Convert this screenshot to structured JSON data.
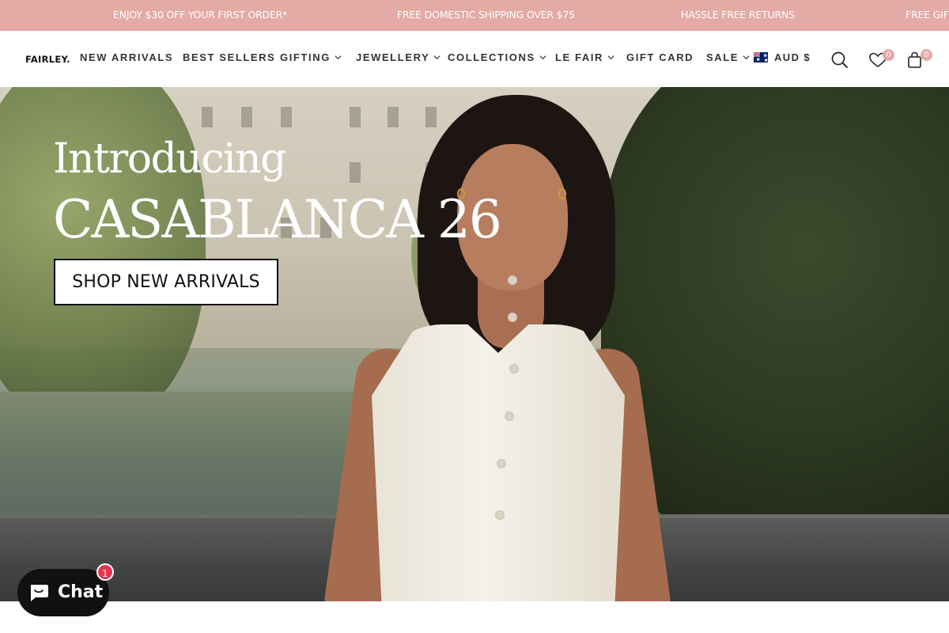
{
  "announcement": {
    "messages": [
      "ENJOY $30 OFF YOUR FIRST ORDER*",
      "FREE DOMESTIC SHIPPING OVER $75",
      "HASSLE FREE RETURNS",
      "FREE GIFT"
    ],
    "background": "#e4aaa6"
  },
  "header": {
    "logo": "FAIRLEY.",
    "nav": [
      {
        "label": "NEW ARRIVALS",
        "has_dropdown": false
      },
      {
        "label": "BEST SELLERS",
        "has_dropdown": false
      },
      {
        "label": "GIFTING",
        "has_dropdown": true
      },
      {
        "label": "JEWELLERY",
        "has_dropdown": true
      },
      {
        "label": "COLLECTIONS",
        "has_dropdown": true
      },
      {
        "label": "LE FAIR",
        "has_dropdown": true
      },
      {
        "label": "GIFT CARD",
        "has_dropdown": false
      },
      {
        "label": "SALE",
        "has_dropdown": true
      }
    ],
    "currency": "AUD $",
    "currency_flag": "australia-flag-icon",
    "wishlist_count": "0",
    "cart_count": "0",
    "icons": [
      "search-icon",
      "heart-icon",
      "bag-icon"
    ],
    "badge_color": "#e4aaa6"
  },
  "hero": {
    "intro": "Introducing",
    "title": "CASABLANCA 26",
    "cta": "SHOP NEW ARRIVALS"
  },
  "chat": {
    "label": "Chat",
    "unread": "1",
    "icon": "chat-bubble-icon"
  }
}
